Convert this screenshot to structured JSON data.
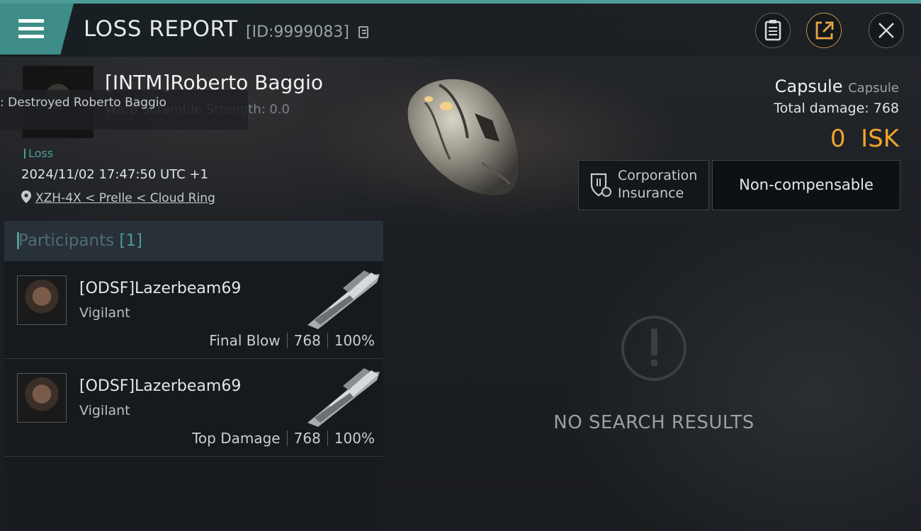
{
  "header": {
    "title": "LOSS REPORT",
    "report_id": "[ID:9999083]"
  },
  "victim": {
    "name": "[INTM]Roberto Baggio",
    "tooltip": ": Destroyed Roberto Baggio",
    "warp_scramble": "Warp Scramble Strength: 0.0",
    "status_tag": "Loss",
    "datetime": "2024/11/02 17:47:50 UTC +1",
    "location": "XZH-4X < Prelle < Cloud Ring"
  },
  "ship": {
    "name": "Capsule",
    "type": "Capsule",
    "total_damage_label": "Total damage:",
    "total_damage": "768",
    "isk_value": "0",
    "isk_unit": "ISK"
  },
  "insurance": {
    "label": "Corporation Insurance",
    "status": "Non-compensable"
  },
  "participants": {
    "title": "Participants",
    "count": "[1]",
    "items": [
      {
        "name": "[ODSF]Lazerbeam69",
        "ship": "Vigilant",
        "role": "Final Blow",
        "damage": "768",
        "percent": "100%"
      },
      {
        "name": "[ODSF]Lazerbeam69",
        "ship": "Vigilant",
        "role": "Top Damage",
        "damage": "768",
        "percent": "100%"
      }
    ]
  },
  "results": {
    "empty_text": "NO SEARCH RESULTS"
  },
  "icons": [
    "menu-icon",
    "copy-icon",
    "clipboard-icon",
    "share-icon",
    "close-icon",
    "location-pin-icon",
    "insurance-icon",
    "alert-icon"
  ],
  "colors": {
    "accent": "#4e9c97",
    "isk": "#f0a52a"
  }
}
